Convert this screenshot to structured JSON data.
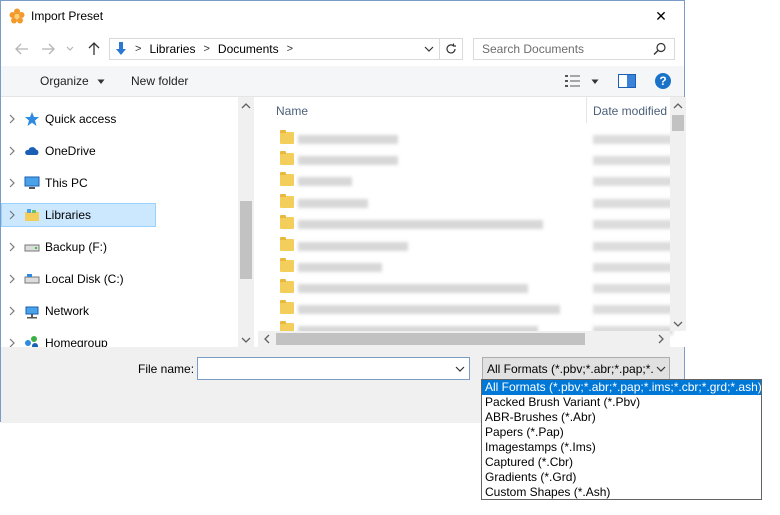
{
  "window": {
    "title": "Import Preset",
    "close_glyph": "✕"
  },
  "address": {
    "segments": [
      "Libraries",
      "Documents"
    ],
    "separator": ">",
    "search_placeholder": "Search Documents"
  },
  "toolbar": {
    "organize_label": "Organize",
    "new_folder_label": "New folder",
    "help_glyph": "?"
  },
  "nav": {
    "items": [
      {
        "label": "Quick access",
        "icon": "star-icon"
      },
      {
        "label": "OneDrive",
        "icon": "cloud-icon"
      },
      {
        "label": "This PC",
        "icon": "computer-icon"
      },
      {
        "label": "Libraries",
        "icon": "library-icon",
        "selected": true
      },
      {
        "label": "Backup (F:)",
        "icon": "drive-icon"
      },
      {
        "label": "Local Disk (C:)",
        "icon": "drive-icon"
      },
      {
        "label": "Network",
        "icon": "network-icon"
      },
      {
        "label": "Homegroup",
        "icon": "homegroup-icon"
      }
    ]
  },
  "files": {
    "col_name": "Name",
    "col_date": "Date modified"
  },
  "footer": {
    "file_name_label": "File name:",
    "file_name_value": "",
    "filter_value": "All Formats (*.pbv;*.abr;*.pap;*.",
    "filter_options": [
      "All Formats (*.pbv;*.abr;*.pap;*.ims;*.cbr;*.grd;*.ash)",
      "Packed Brush Variant (*.Pbv)",
      "ABR-Brushes (*.Abr)",
      "Papers (*.Pap)",
      "Imagestamps (*.Ims)",
      "Captured (*.Cbr)",
      "Gradients (*.Grd)",
      "Custom Shapes (*.Ash)"
    ]
  },
  "colors": {
    "accent": "#0078d7",
    "selection_bg": "#cce8ff",
    "folder": "#f4ce5b",
    "help": "#1a73c9"
  }
}
